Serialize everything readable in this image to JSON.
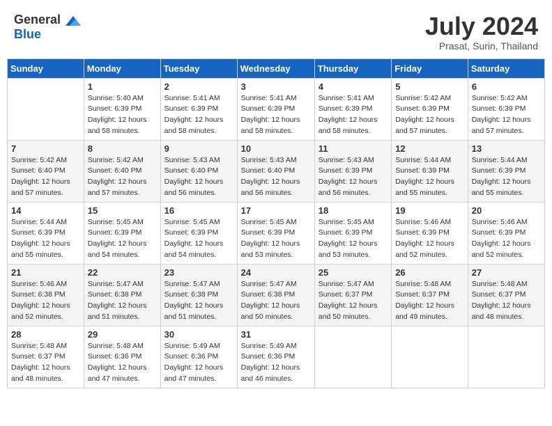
{
  "header": {
    "logo_general": "General",
    "logo_blue": "Blue",
    "month_year": "July 2024",
    "location": "Prasat, Surin, Thailand"
  },
  "days_of_week": [
    "Sunday",
    "Monday",
    "Tuesday",
    "Wednesday",
    "Thursday",
    "Friday",
    "Saturday"
  ],
  "weeks": [
    [
      {
        "day": "",
        "info": ""
      },
      {
        "day": "1",
        "info": "Sunrise: 5:40 AM\nSunset: 6:39 PM\nDaylight: 12 hours\nand 58 minutes."
      },
      {
        "day": "2",
        "info": "Sunrise: 5:41 AM\nSunset: 6:39 PM\nDaylight: 12 hours\nand 58 minutes."
      },
      {
        "day": "3",
        "info": "Sunrise: 5:41 AM\nSunset: 6:39 PM\nDaylight: 12 hours\nand 58 minutes."
      },
      {
        "day": "4",
        "info": "Sunrise: 5:41 AM\nSunset: 6:39 PM\nDaylight: 12 hours\nand 58 minutes."
      },
      {
        "day": "5",
        "info": "Sunrise: 5:42 AM\nSunset: 6:39 PM\nDaylight: 12 hours\nand 57 minutes."
      },
      {
        "day": "6",
        "info": "Sunrise: 5:42 AM\nSunset: 6:39 PM\nDaylight: 12 hours\nand 57 minutes."
      }
    ],
    [
      {
        "day": "7",
        "info": "Sunrise: 5:42 AM\nSunset: 6:40 PM\nDaylight: 12 hours\nand 57 minutes."
      },
      {
        "day": "8",
        "info": "Sunrise: 5:42 AM\nSunset: 6:40 PM\nDaylight: 12 hours\nand 57 minutes."
      },
      {
        "day": "9",
        "info": "Sunrise: 5:43 AM\nSunset: 6:40 PM\nDaylight: 12 hours\nand 56 minutes."
      },
      {
        "day": "10",
        "info": "Sunrise: 5:43 AM\nSunset: 6:40 PM\nDaylight: 12 hours\nand 56 minutes."
      },
      {
        "day": "11",
        "info": "Sunrise: 5:43 AM\nSunset: 6:39 PM\nDaylight: 12 hours\nand 56 minutes."
      },
      {
        "day": "12",
        "info": "Sunrise: 5:44 AM\nSunset: 6:39 PM\nDaylight: 12 hours\nand 55 minutes."
      },
      {
        "day": "13",
        "info": "Sunrise: 5:44 AM\nSunset: 6:39 PM\nDaylight: 12 hours\nand 55 minutes."
      }
    ],
    [
      {
        "day": "14",
        "info": "Sunrise: 5:44 AM\nSunset: 6:39 PM\nDaylight: 12 hours\nand 55 minutes."
      },
      {
        "day": "15",
        "info": "Sunrise: 5:45 AM\nSunset: 6:39 PM\nDaylight: 12 hours\nand 54 minutes."
      },
      {
        "day": "16",
        "info": "Sunrise: 5:45 AM\nSunset: 6:39 PM\nDaylight: 12 hours\nand 54 minutes."
      },
      {
        "day": "17",
        "info": "Sunrise: 5:45 AM\nSunset: 6:39 PM\nDaylight: 12 hours\nand 53 minutes."
      },
      {
        "day": "18",
        "info": "Sunrise: 5:45 AM\nSunset: 6:39 PM\nDaylight: 12 hours\nand 53 minutes."
      },
      {
        "day": "19",
        "info": "Sunrise: 5:46 AM\nSunset: 6:39 PM\nDaylight: 12 hours\nand 52 minutes."
      },
      {
        "day": "20",
        "info": "Sunrise: 5:46 AM\nSunset: 6:39 PM\nDaylight: 12 hours\nand 52 minutes."
      }
    ],
    [
      {
        "day": "21",
        "info": "Sunrise: 5:46 AM\nSunset: 6:38 PM\nDaylight: 12 hours\nand 52 minutes."
      },
      {
        "day": "22",
        "info": "Sunrise: 5:47 AM\nSunset: 6:38 PM\nDaylight: 12 hours\nand 51 minutes."
      },
      {
        "day": "23",
        "info": "Sunrise: 5:47 AM\nSunset: 6:38 PM\nDaylight: 12 hours\nand 51 minutes."
      },
      {
        "day": "24",
        "info": "Sunrise: 5:47 AM\nSunset: 6:38 PM\nDaylight: 12 hours\nand 50 minutes."
      },
      {
        "day": "25",
        "info": "Sunrise: 5:47 AM\nSunset: 6:37 PM\nDaylight: 12 hours\nand 50 minutes."
      },
      {
        "day": "26",
        "info": "Sunrise: 5:48 AM\nSunset: 6:37 PM\nDaylight: 12 hours\nand 49 minutes."
      },
      {
        "day": "27",
        "info": "Sunrise: 5:48 AM\nSunset: 6:37 PM\nDaylight: 12 hours\nand 48 minutes."
      }
    ],
    [
      {
        "day": "28",
        "info": "Sunrise: 5:48 AM\nSunset: 6:37 PM\nDaylight: 12 hours\nand 48 minutes."
      },
      {
        "day": "29",
        "info": "Sunrise: 5:48 AM\nSunset: 6:36 PM\nDaylight: 12 hours\nand 47 minutes."
      },
      {
        "day": "30",
        "info": "Sunrise: 5:49 AM\nSunset: 6:36 PM\nDaylight: 12 hours\nand 47 minutes."
      },
      {
        "day": "31",
        "info": "Sunrise: 5:49 AM\nSunset: 6:36 PM\nDaylight: 12 hours\nand 46 minutes."
      },
      {
        "day": "",
        "info": ""
      },
      {
        "day": "",
        "info": ""
      },
      {
        "day": "",
        "info": ""
      }
    ]
  ]
}
